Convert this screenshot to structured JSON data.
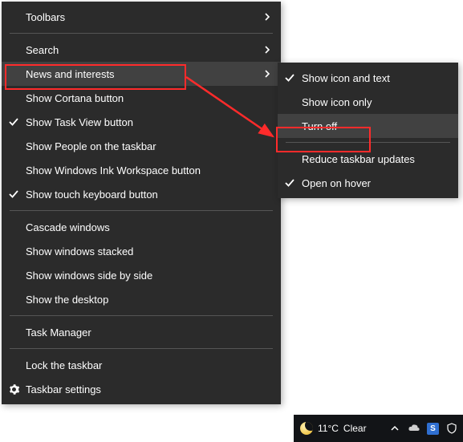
{
  "mainMenu": {
    "items": [
      {
        "label": "Toolbars",
        "checked": false,
        "submenu": true,
        "gear": false
      },
      {
        "sep": true
      },
      {
        "label": "Search",
        "checked": false,
        "submenu": true,
        "gear": false
      },
      {
        "label": "News and interests",
        "checked": false,
        "submenu": true,
        "gear": false,
        "hovered": true
      },
      {
        "label": "Show Cortana button",
        "checked": false,
        "submenu": false,
        "gear": false
      },
      {
        "label": "Show Task View button",
        "checked": true,
        "submenu": false,
        "gear": false
      },
      {
        "label": "Show People on the taskbar",
        "checked": false,
        "submenu": false,
        "gear": false
      },
      {
        "label": "Show Windows Ink Workspace button",
        "checked": false,
        "submenu": false,
        "gear": false
      },
      {
        "label": "Show touch keyboard button",
        "checked": true,
        "submenu": false,
        "gear": false
      },
      {
        "sep": true
      },
      {
        "label": "Cascade windows",
        "checked": false,
        "submenu": false,
        "gear": false
      },
      {
        "label": "Show windows stacked",
        "checked": false,
        "submenu": false,
        "gear": false
      },
      {
        "label": "Show windows side by side",
        "checked": false,
        "submenu": false,
        "gear": false
      },
      {
        "label": "Show the desktop",
        "checked": false,
        "submenu": false,
        "gear": false
      },
      {
        "sep": true
      },
      {
        "label": "Task Manager",
        "checked": false,
        "submenu": false,
        "gear": false
      },
      {
        "sep": true
      },
      {
        "label": "Lock the taskbar",
        "checked": false,
        "submenu": false,
        "gear": false
      },
      {
        "label": "Taskbar settings",
        "checked": false,
        "submenu": false,
        "gear": true
      }
    ]
  },
  "subMenu": {
    "items": [
      {
        "label": "Show icon and text",
        "checked": true,
        "hovered": false
      },
      {
        "label": "Show icon only",
        "checked": false,
        "hovered": false
      },
      {
        "label": "Turn off",
        "checked": false,
        "hovered": true
      },
      {
        "sep": true
      },
      {
        "label": "Reduce taskbar updates",
        "checked": false,
        "hovered": false
      },
      {
        "label": "Open on hover",
        "checked": true,
        "hovered": false
      }
    ]
  },
  "taskbar": {
    "weather": {
      "temp": "11°C",
      "label": "Clear"
    },
    "tray": {
      "badge": "S"
    }
  },
  "colors": {
    "highlight": "#ff2b2b"
  }
}
